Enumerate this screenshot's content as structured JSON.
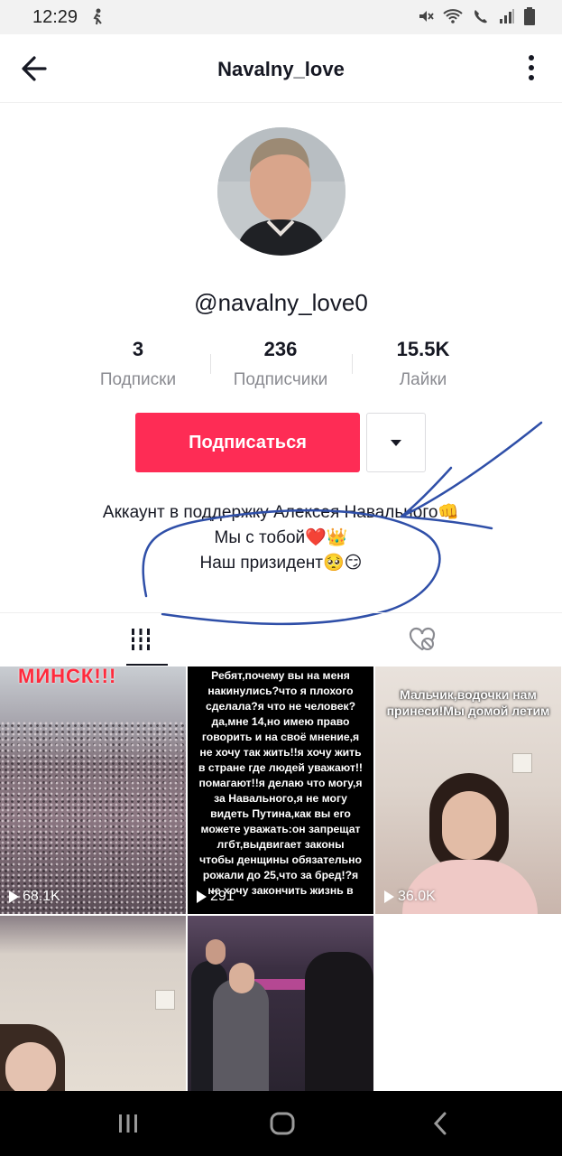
{
  "status_bar": {
    "time": "12:29",
    "left_icons": [
      "person-walk-icon"
    ],
    "right_icons": [
      "mute-icon",
      "wifi-icon",
      "call-icon",
      "signal-icon",
      "battery-icon"
    ]
  },
  "header": {
    "title": "Navalny_love",
    "back_icon": "arrow-left-icon",
    "more_icon": "more-vertical-icon"
  },
  "profile": {
    "username": "@navalny_love0",
    "stats": [
      {
        "value": "3",
        "label": "Подписки"
      },
      {
        "value": "236",
        "label": "Подписчики"
      },
      {
        "value": "15.5K",
        "label": "Лайки"
      }
    ],
    "follow_label": "Подписаться",
    "bio_lines": [
      "Аккаунт в поддержку Алексея Навального👊",
      "Мы с тобой❤️👑",
      "Наш призидент🥺😏"
    ]
  },
  "tabs": [
    {
      "icon": "grid-icon",
      "selected": true
    },
    {
      "icon": "liked-hidden-icon",
      "selected": false
    }
  ],
  "videos": [
    {
      "caption": "МИНСК!!!",
      "views": "68.1K"
    },
    {
      "caption": "Ребят,почему вы на меня накинулись?что я плохого сделала?я что не человек?да,мне 14,но имею право говорить и на своё мнение,я не хочу так жить!!я хочу жить в стране где людей уважают!!помагают!!я делаю что могу,я за Навального,я не могу видеть Путина,как вы его можете уважать:он запрещат лгбт,выдвигает законы чтобы денщины обязательно рожали до 25,что за бред!?я не хочу закончить жизнь в",
      "views": "291"
    },
    {
      "caption": "Мальчик,водочки нам принеси!Мы домой летим",
      "views": "36.0K"
    },
    {
      "caption": "",
      "views": ""
    },
    {
      "caption": "",
      "views": ""
    }
  ],
  "nav_bar": {
    "icons": [
      "recent-apps-icon",
      "home-icon",
      "back-icon"
    ]
  },
  "colors": {
    "accent": "#fe2c55",
    "annotation": "#2f4fa8"
  }
}
